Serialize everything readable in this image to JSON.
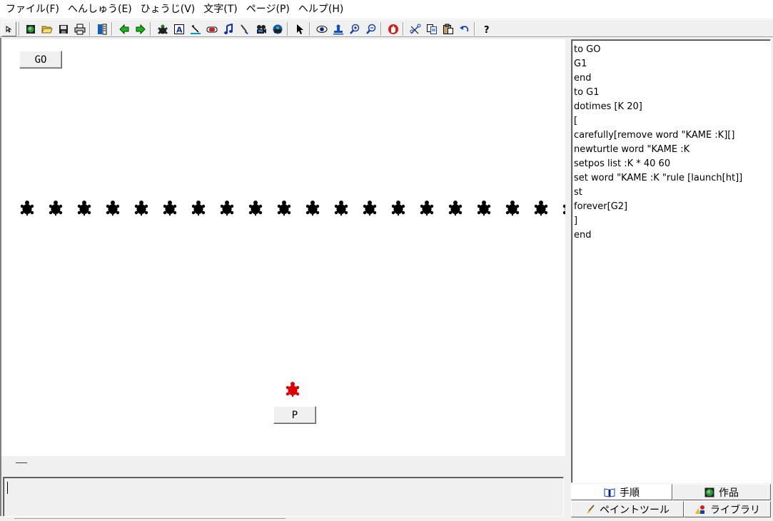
{
  "menu": [
    "ファイル(F)",
    "へんしゅう(E)",
    "ひょうじ(V)",
    "文字(T)",
    "ページ(P)",
    "ヘルプ(H)"
  ],
  "toolbar": {
    "icons": [
      "cursor-small-icon",
      "new-page-icon",
      "open-folder-icon",
      "save-icon",
      "print-icon",
      "page-list-icon",
      "back-arrow-icon",
      "forward-arrow-icon",
      "new-turtle-icon",
      "text-box-icon",
      "slider-icon",
      "button-icon",
      "music-icon",
      "paint-brush-icon",
      "movie-icon",
      "record-icon",
      "pointer-icon",
      "eye-icon",
      "stamp-icon",
      "zoom-in-icon",
      "zoom-out-icon",
      "stop-hand-icon",
      "cut-icon",
      "copy-icon",
      "paste-icon",
      "undo-icon",
      "help-icon"
    ]
  },
  "canvas": {
    "go_button": "GO",
    "p_button": "P",
    "turtle_count": 20,
    "turtle_color": "#000000",
    "red_turtle_color": "#e00000"
  },
  "procedures": {
    "lines": [
      "to GO",
      "G1",
      "end",
      "to G1",
      "dotimes [K 20]",
      "[",
      "carefully[remove word \"KAME :K][]",
      "newturtle word \"KAME :K",
      "setpos list :K * 40 60",
      "set word \"KAME :K \"rule [launch[ht]]",
      "st",
      "forever[G2]",
      "]",
      "end"
    ]
  },
  "tabs": {
    "procedures": "手順",
    "works": "作品",
    "paint": "ペイントツール",
    "library": "ライブラリ"
  }
}
